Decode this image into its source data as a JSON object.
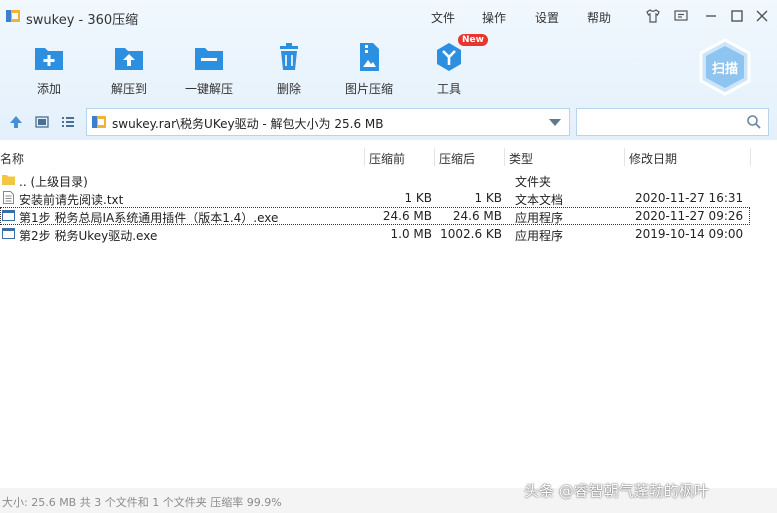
{
  "window": {
    "title": "swukey - 360压缩",
    "menu": [
      "文件",
      "操作",
      "设置",
      "帮助"
    ]
  },
  "toolbar": {
    "items": [
      {
        "label": "添加",
        "icon": "add-folder-icon"
      },
      {
        "label": "解压到",
        "icon": "extract-to-icon"
      },
      {
        "label": "一键解压",
        "icon": "one-click-extract-icon"
      },
      {
        "label": "删除",
        "icon": "trash-icon"
      },
      {
        "label": "图片压缩",
        "icon": "image-compress-icon"
      },
      {
        "label": "工具",
        "icon": "tools-icon",
        "badge": "New"
      }
    ],
    "scan_label": "扫描"
  },
  "address": {
    "path": "swukey.rar\\税务UKey驱动 - 解包大小为 25.6 MB"
  },
  "search": {
    "placeholder": ""
  },
  "table": {
    "columns": [
      "名称",
      "压缩前",
      "压缩后",
      "类型",
      "修改日期"
    ],
    "rows": [
      {
        "name": ".. (上级目录)",
        "before": "",
        "after": "",
        "type": "文件夹",
        "date": "",
        "icon": "folder-icon"
      },
      {
        "name": "安装前请先阅读.txt",
        "before": "1 KB",
        "after": "1 KB",
        "type": "文本文档",
        "date": "2020-11-27 16:31",
        "icon": "text-file-icon"
      },
      {
        "name": "第1步 税务总局IA系统通用插件（版本1.4）.exe",
        "before": "24.6 MB",
        "after": "24.6 MB",
        "type": "应用程序",
        "date": "2020-11-27 09:26",
        "icon": "exe-file-icon",
        "selected": true
      },
      {
        "name": "第2步 税务Ukey驱动.exe",
        "before": "1.0 MB",
        "after": "1002.6 KB",
        "type": "应用程序",
        "date": "2019-10-14 09:00",
        "icon": "exe-file-icon"
      }
    ]
  },
  "status": {
    "text": "大小: 25.6 MB 共 3 个文件和 1 个文件夹 压缩率 99.9%"
  },
  "watermark": "头条 @睿智朝气蓬勃的枫叶",
  "colors": {
    "accent": "#2d8fe0",
    "toolbar_bg": "#e6f2fc",
    "badge": "#e8352f"
  }
}
